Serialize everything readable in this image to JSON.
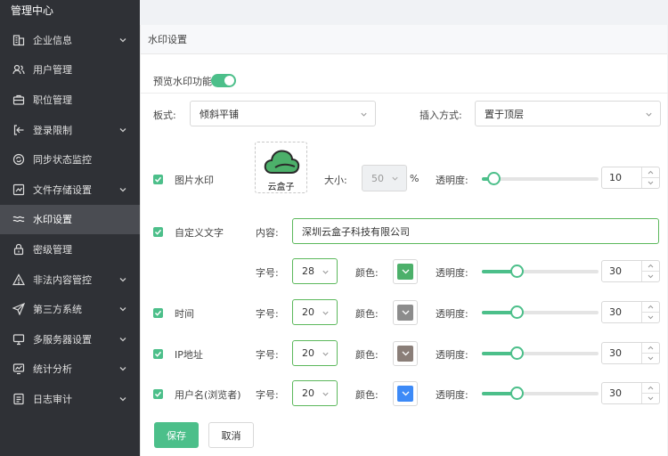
{
  "brand": "管理中心",
  "sidebar": {
    "items": [
      {
        "label": "企业信息",
        "icon": "building-icon",
        "expandable": true
      },
      {
        "label": "用户管理",
        "icon": "users-icon",
        "expandable": false
      },
      {
        "label": "职位管理",
        "icon": "briefcase-icon",
        "expandable": false
      },
      {
        "label": "登录限制",
        "icon": "login-icon",
        "expandable": true
      },
      {
        "label": "同步状态监控",
        "icon": "sync-icon",
        "expandable": false
      },
      {
        "label": "文件存储设置",
        "icon": "storage-icon",
        "expandable": true
      },
      {
        "label": "水印设置",
        "icon": "watermark-icon",
        "expandable": false,
        "active": true
      },
      {
        "label": "密级管理",
        "icon": "lock-icon",
        "expandable": false
      },
      {
        "label": "非法内容管控",
        "icon": "warning-icon",
        "expandable": true
      },
      {
        "label": "第三方系统",
        "icon": "send-icon",
        "expandable": true
      },
      {
        "label": "多服务器设置",
        "icon": "monitor-icon",
        "expandable": true
      },
      {
        "label": "统计分析",
        "icon": "chart-icon",
        "expandable": true
      },
      {
        "label": "日志审计",
        "icon": "log-icon",
        "expandable": true
      }
    ]
  },
  "page": {
    "title": "水印设置",
    "preview_label": "预览水印功能",
    "preview_enabled": true,
    "layout_label": "板式:",
    "layout_value": "倾斜平铺",
    "insert_label": "插入方式:",
    "insert_value": "置于顶层",
    "image_watermark": {
      "label": "图片水印",
      "logo_text": "云盒子",
      "size_label": "大小:",
      "size_value": "50",
      "size_unit": "%",
      "opacity_label": "透明度:",
      "opacity_value": "10"
    },
    "custom_text": {
      "label": "自定义文字",
      "content_label": "内容:",
      "content_value": "深圳云盒子科技有限公司",
      "font_label": "字号:",
      "font_value": "28",
      "color_label": "颜色:",
      "color": "#4cb06a",
      "opacity_label": "透明度:",
      "opacity_value": "30"
    },
    "time": {
      "label": "时间",
      "font_label": "字号:",
      "font_value": "20",
      "color_label": "颜色:",
      "color": "#8c8c8c",
      "opacity_label": "透明度:",
      "opacity_value": "30"
    },
    "ip": {
      "label": "IP地址",
      "font_label": "字号:",
      "font_value": "20",
      "color_label": "颜色:",
      "color": "#8a7e78",
      "opacity_label": "透明度:",
      "opacity_value": "30"
    },
    "username": {
      "label": "用户名(浏览者)",
      "font_label": "字号:",
      "font_value": "20",
      "color_label": "颜色:",
      "color": "#3d8af7",
      "opacity_label": "透明度:",
      "opacity_value": "30"
    },
    "save_label": "保存",
    "cancel_label": "取消"
  },
  "colors": {
    "accent": "#4cbf8a",
    "sidebar_bg": "#2f3136",
    "sidebar_active": "#4a4c52"
  }
}
